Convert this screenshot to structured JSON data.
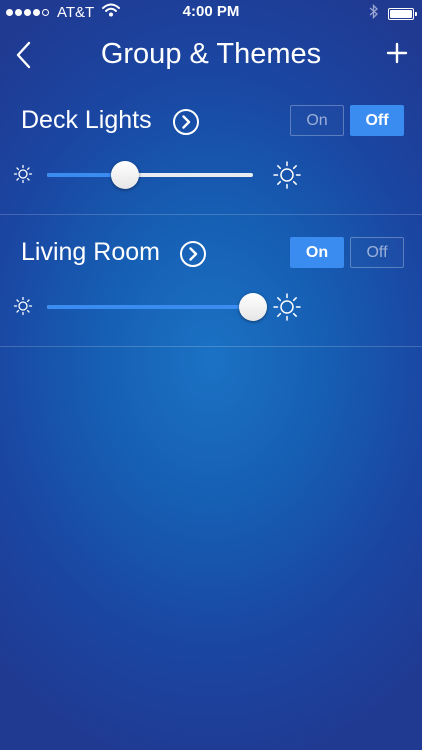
{
  "status_bar": {
    "carrier": "AT&T",
    "time": "4:00 PM",
    "signal_bars_filled": 4,
    "signal_bars_total": 5,
    "icons": [
      "wifi-icon",
      "bluetooth-icon",
      "battery-icon"
    ]
  },
  "nav": {
    "title": "Group & Themes",
    "back_icon": "chevron-left-icon",
    "add_icon": "plus-icon"
  },
  "groups": [
    {
      "name": "Deck Lights",
      "on_label": "On",
      "off_label": "Off",
      "state": "off",
      "brightness": 0.38
    },
    {
      "name": "Living Room",
      "on_label": "On",
      "off_label": "Off",
      "state": "on",
      "brightness": 1.0
    }
  ],
  "colors": {
    "accent": "#3b8cf1",
    "background_center": "#1b72c4",
    "background_edge": "#203a92",
    "track": "#e9ecf0"
  }
}
